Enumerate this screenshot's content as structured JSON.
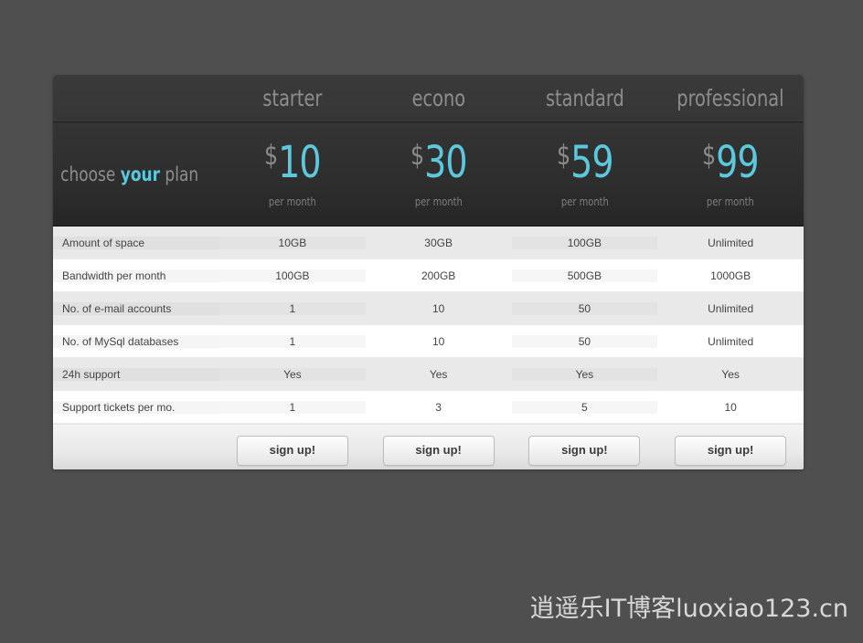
{
  "panel": {
    "headline_prefix": "choose ",
    "headline_accent": "your",
    "headline_suffix": " plan",
    "accent_color": "#5bc8dc",
    "muted_color": "#8d8d8d"
  },
  "plans": [
    {
      "name": "starter",
      "currency": "$",
      "amount": "10",
      "period": "per month",
      "cta": "sign up!"
    },
    {
      "name": "econo",
      "currency": "$",
      "amount": "30",
      "period": "per month",
      "cta": "sign up!"
    },
    {
      "name": "standard",
      "currency": "$",
      "amount": "59",
      "period": "per month",
      "cta": "sign up!"
    },
    {
      "name": "professional",
      "currency": "$",
      "amount": "99",
      "period": "per month",
      "cta": "sign up!"
    }
  ],
  "features": [
    {
      "label": "Amount of space",
      "values": [
        "10GB",
        "30GB",
        "100GB",
        "Unlimited"
      ]
    },
    {
      "label": "Bandwidth per month",
      "values": [
        "100GB",
        "200GB",
        "500GB",
        "1000GB"
      ]
    },
    {
      "label": "No. of e-mail accounts",
      "values": [
        "1",
        "10",
        "50",
        "Unlimited"
      ]
    },
    {
      "label": "No. of MySql databases",
      "values": [
        "1",
        "10",
        "50",
        "Unlimited"
      ]
    },
    {
      "label": "24h support",
      "values": [
        "Yes",
        "Yes",
        "Yes",
        "Yes"
      ]
    },
    {
      "label": "Support tickets per mo.",
      "values": [
        "1",
        "3",
        "5",
        "10"
      ]
    }
  ],
  "watermark": {
    "text": "逍遥乐IT博客luoxiao123.cn"
  }
}
